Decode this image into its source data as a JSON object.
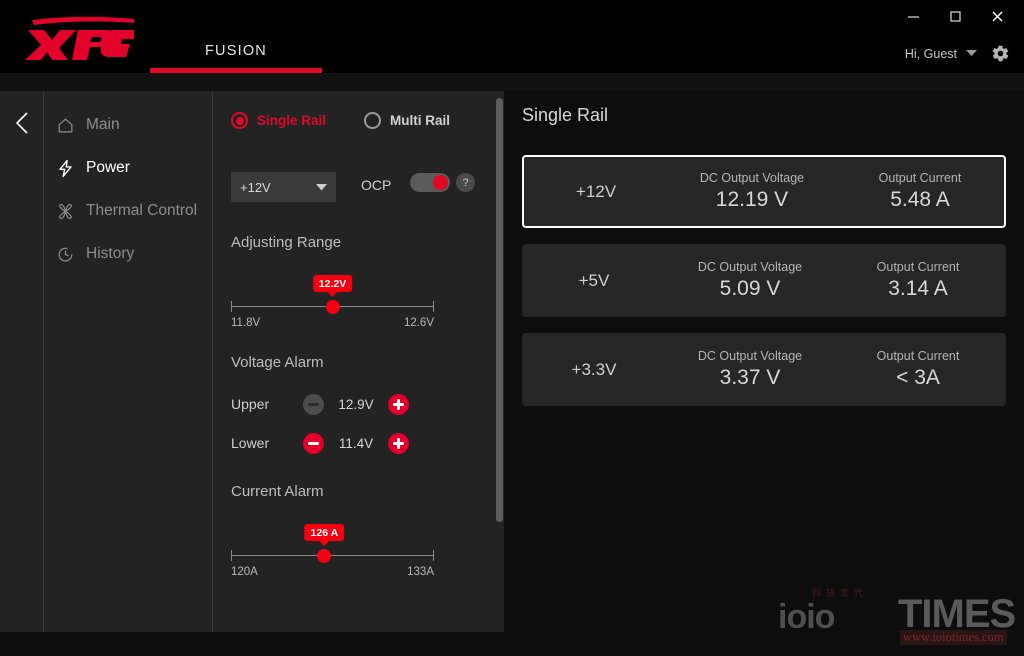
{
  "app": {
    "brand": "XPG",
    "tab_label": "FUSION",
    "accent_red": "#e00a24",
    "bright_red": "#f5000f",
    "panel_bg": "#232323",
    "content_bg": "#0d0d0d",
    "card_bg": "#262626"
  },
  "window_controls": {
    "minimize": "minimize-icon",
    "maximize": "maximize-icon",
    "close": "close-icon"
  },
  "user": {
    "greeting": "Hi, Guest",
    "caret": "chevron-down-icon",
    "settings": "gear-icon"
  },
  "sidebar": {
    "back": "chevron-left-icon",
    "items": [
      {
        "label": "Main",
        "icon": "home-icon",
        "active": false
      },
      {
        "label": "Power",
        "icon": "lightning-bolt-icon",
        "active": true
      },
      {
        "label": "Thermal Control",
        "icon": "fan-icon",
        "active": false
      },
      {
        "label": "History",
        "icon": "clock-icon",
        "active": false
      }
    ]
  },
  "settings": {
    "rail_mode": [
      {
        "label": "Single Rail",
        "selected": true
      },
      {
        "label": "Multi Rail",
        "selected": false
      }
    ],
    "rail_select": {
      "value": "+12V",
      "caret": "caret-down-icon"
    },
    "ocp": {
      "label": "OCP",
      "enabled": true,
      "help": "?"
    },
    "adjusting_range": {
      "title": "Adjusting Range",
      "value": "12.2V",
      "min": "11.8V",
      "max": "12.6V",
      "position_pct": 50
    },
    "voltage_alarm": {
      "title": "Voltage Alarm",
      "rows": [
        {
          "name": "Upper",
          "value": "12.9V",
          "minus_disabled": true,
          "plus_disabled": false
        },
        {
          "name": "Lower",
          "value": "11.4V",
          "minus_disabled": false,
          "plus_disabled": false
        }
      ]
    },
    "current_alarm": {
      "title": "Current Alarm",
      "value": "126 A",
      "min": "120A",
      "max": "133A",
      "position_pct": 46
    }
  },
  "content": {
    "title": "Single Rail",
    "metric_labels": {
      "voltage": "DC Output Voltage",
      "current": "Output Current"
    },
    "rails": [
      {
        "name": "+12V",
        "voltage": "12.19 V",
        "current": "5.48 A",
        "selected": true
      },
      {
        "name": "+5V",
        "voltage": "5.09 V",
        "current": "3.14 A",
        "selected": false
      },
      {
        "name": "+3.3V",
        "voltage": "3.37 V",
        "current": "< 3A",
        "selected": false
      }
    ]
  },
  "watermark": {
    "cn": "科技世代",
    "ioio": "ioio",
    "times": "TIMES",
    "url": "www.ioiotimes.com"
  }
}
